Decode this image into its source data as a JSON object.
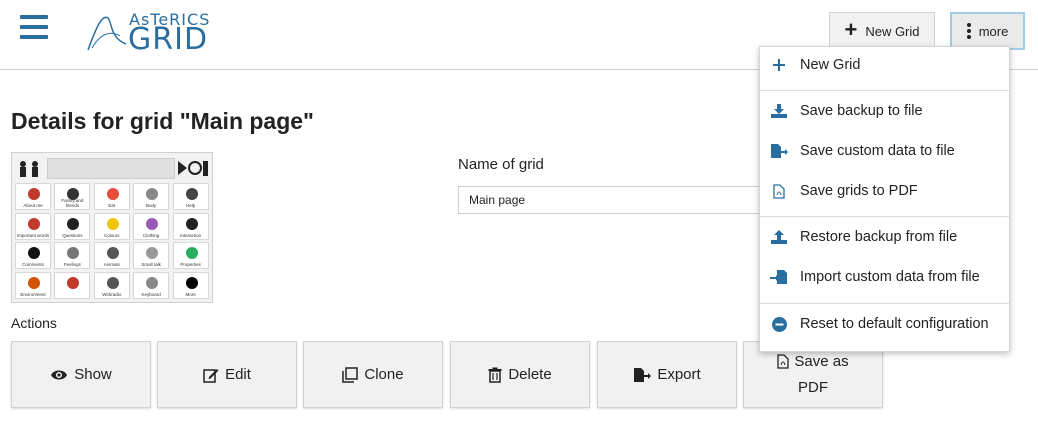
{
  "header": {
    "logo_top": "AsTeRICS",
    "logo_main": "GRID",
    "new_grid_label": "New Grid",
    "more_label": "more"
  },
  "main": {
    "title": "Details for grid \"Main page\"",
    "name_label": "Name of grid",
    "name_value": "Main page",
    "actions_label": "Actions",
    "thumbnail_cells": [
      "About me",
      "Family and friends",
      "Eat",
      "Body",
      "Help",
      "Important words",
      "Questions",
      "Colours",
      "Clothing",
      "Interaction",
      "Comments",
      "Feelings",
      "Animals",
      "Small talk",
      "Properties",
      "Environment",
      "",
      "Webradio",
      "Keyboard",
      "More"
    ]
  },
  "actions": [
    {
      "label": "Show",
      "icon": "eye-icon"
    },
    {
      "label": "Edit",
      "icon": "edit-icon"
    },
    {
      "label": "Clone",
      "icon": "clone-icon"
    },
    {
      "label": "Delete",
      "icon": "trash-icon"
    },
    {
      "label": "Export",
      "icon": "export-icon"
    },
    {
      "label_line1": "Save as",
      "label_line2": "PDF",
      "icon": "pdf-icon"
    }
  ],
  "dropdown": {
    "items": [
      {
        "label": "New Grid",
        "icon": "plus-icon"
      },
      {
        "label": "Save backup to file",
        "icon": "download-icon"
      },
      {
        "label": "Save custom data to file",
        "icon": "file-export-icon"
      },
      {
        "label": "Save grids to PDF",
        "icon": "pdf-icon"
      },
      {
        "label": "Restore backup from file",
        "icon": "upload-icon"
      },
      {
        "label": "Import custom data from file",
        "icon": "file-import-icon"
      },
      {
        "label": "Reset to default configuration",
        "icon": "minus-circle-icon"
      }
    ]
  },
  "colors": {
    "accent": "#2a6ea0",
    "button_bg": "#f1f1f1",
    "border": "#d2d2d2"
  }
}
